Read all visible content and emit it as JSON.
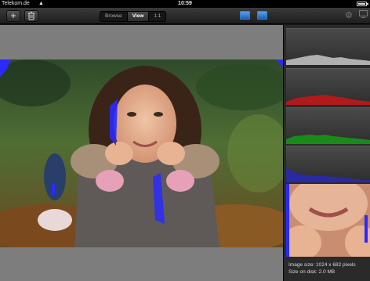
{
  "status_bar": {
    "carrier": "Telekom.de",
    "wifi_icon": "wifi-icon",
    "time": "10:59",
    "battery_level": 0.8
  },
  "toolbar": {
    "add_icon": "plus-icon",
    "delete_icon": "trash-icon",
    "segments": [
      {
        "label": "Browse",
        "active": false
      },
      {
        "label": "View",
        "active": true
      },
      {
        "label": "1:1",
        "active": false
      }
    ],
    "view_icons": [
      "image-view-icon",
      "image-view-alt-icon"
    ],
    "settings_icon": "gear-icon",
    "screen_icon": "display-icon",
    "accent": "#3a86e0"
  },
  "image": {
    "clipping_overlay_color": "#2a2aff"
  },
  "histograms": [
    {
      "channel": "luminance",
      "color": "#b0b0b0"
    },
    {
      "channel": "red",
      "color": "#b01a1a"
    },
    {
      "channel": "green",
      "color": "#1a8a1a"
    },
    {
      "channel": "blue",
      "color": "#2a2aa0"
    }
  ],
  "info": {
    "image_size": "Image size: 1024 x 682 pixels",
    "disk_size": "Size on disk: 2.0 MB"
  }
}
